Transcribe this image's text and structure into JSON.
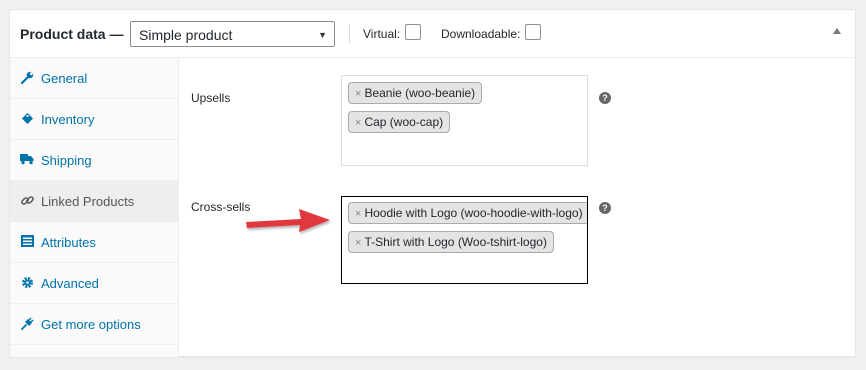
{
  "header": {
    "title": "Product data —",
    "product_type": "Simple product",
    "virtual_label": "Virtual:",
    "downloadable_label": "Downloadable:"
  },
  "sidebar": {
    "items": [
      {
        "label": "General",
        "icon": "wrench-icon"
      },
      {
        "label": "Inventory",
        "icon": "tag-icon"
      },
      {
        "label": "Shipping",
        "icon": "truck-icon"
      },
      {
        "label": "Linked Products",
        "icon": "link-icon",
        "active": true
      },
      {
        "label": "Attributes",
        "icon": "list-icon"
      },
      {
        "label": "Advanced",
        "icon": "gear-icon"
      },
      {
        "label": "Get more options",
        "icon": "plugin-icon"
      }
    ]
  },
  "linked": {
    "upsells_label": "Upsells",
    "upsells": [
      "Beanie (woo-beanie)",
      "Cap (woo-cap)"
    ],
    "crosssells_label": "Cross-sells",
    "crosssells": [
      "Hoodie with Logo (woo-hoodie-with-logo)",
      "T-Shirt with Logo (Woo-tshirt-logo)"
    ],
    "chip_remove": "×",
    "help_glyph": "?"
  },
  "colors": {
    "link": "#0073aa",
    "annotation_arrow": "#e0393e"
  }
}
